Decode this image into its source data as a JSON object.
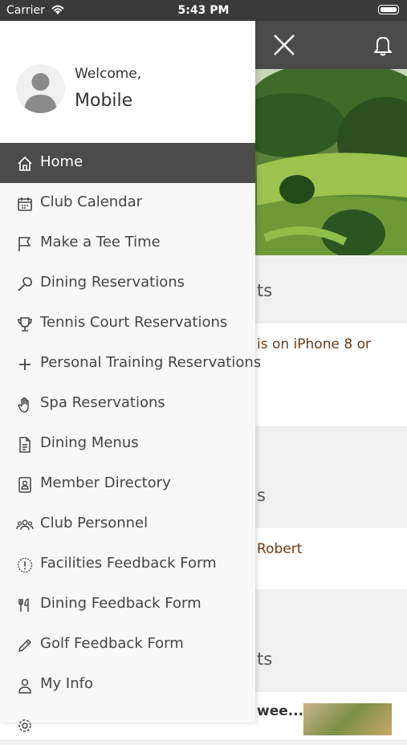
{
  "status": {
    "carrier": "Carrier",
    "time": "5:43 PM"
  },
  "drawer": {
    "welcome": "Welcome,",
    "user_name": "Mobile",
    "items": [
      {
        "label": "Home",
        "icon": "home-icon",
        "active": true
      },
      {
        "label": "Club Calendar",
        "icon": "calendar-icon"
      },
      {
        "label": "Make a Tee Time",
        "icon": "flag-icon"
      },
      {
        "label": "Dining Reservations",
        "icon": "wrench-icon"
      },
      {
        "label": "Tennis Court Reservations",
        "icon": "trophy-icon"
      },
      {
        "label": "Personal Training Reservations",
        "icon": "plus-icon"
      },
      {
        "label": "Spa Reservations",
        "icon": "hand-icon"
      },
      {
        "label": "Dining Menus",
        "icon": "document-icon"
      },
      {
        "label": "Member Directory",
        "icon": "contact-card-icon"
      },
      {
        "label": "Club Personnel",
        "icon": "people-icon"
      },
      {
        "label": "Facilities Feedback Form",
        "icon": "alert-circle-icon"
      },
      {
        "label": "Dining Feedback Form",
        "icon": "utensils-icon"
      },
      {
        "label": "Golf Feedback Form",
        "icon": "pencil-icon"
      },
      {
        "label": "My Info",
        "icon": "person-icon"
      }
    ]
  },
  "background": {
    "section1_title_fragment": "ts",
    "row1_fragment": "is on iPhone 8 or",
    "section2_title_fragment": "s",
    "row2_fragment": "Robert",
    "section3_title_fragment": "ts",
    "row3_fragment": "wee..."
  },
  "colors": {
    "header": "#4b4b4b",
    "active_item": "#4b4b4b",
    "accent_text": "#6b3b14"
  }
}
